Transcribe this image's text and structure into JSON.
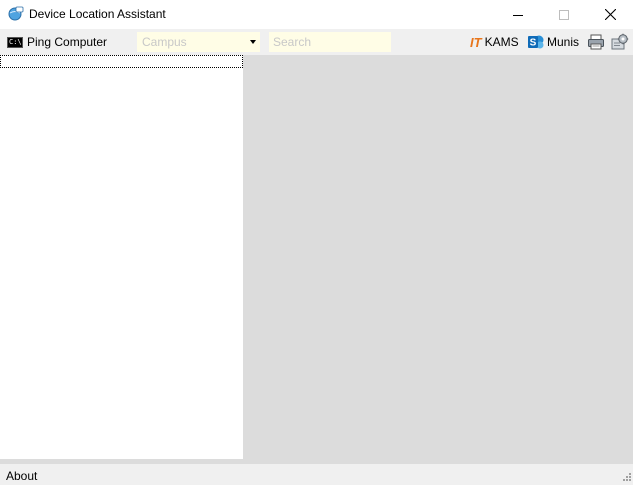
{
  "window": {
    "title": "Device Location Assistant"
  },
  "toolbar": {
    "ping_label": "Ping Computer",
    "campus_value": "Campus",
    "search_placeholder": "Search",
    "kams_label": "KAMS",
    "kams_icon_text": "IT",
    "munis_label": "Munis"
  },
  "statusbar": {
    "about_label": "About"
  },
  "icons": {
    "app": "globe-chat-icon",
    "ping": "cmd-prompt-icon",
    "kams": "it-logo-icon",
    "munis": "sharepoint-icon",
    "print": "printer-icon",
    "settings": "settings-icon"
  },
  "colors": {
    "input_background": "#fffde6",
    "placeholder": "#c8c8c8",
    "kams_orange": "#e8751a",
    "sharepoint_blue": "#0f6bb8",
    "content_background": "#dcdcdc",
    "toolbar_background": "#f0f0f0"
  }
}
